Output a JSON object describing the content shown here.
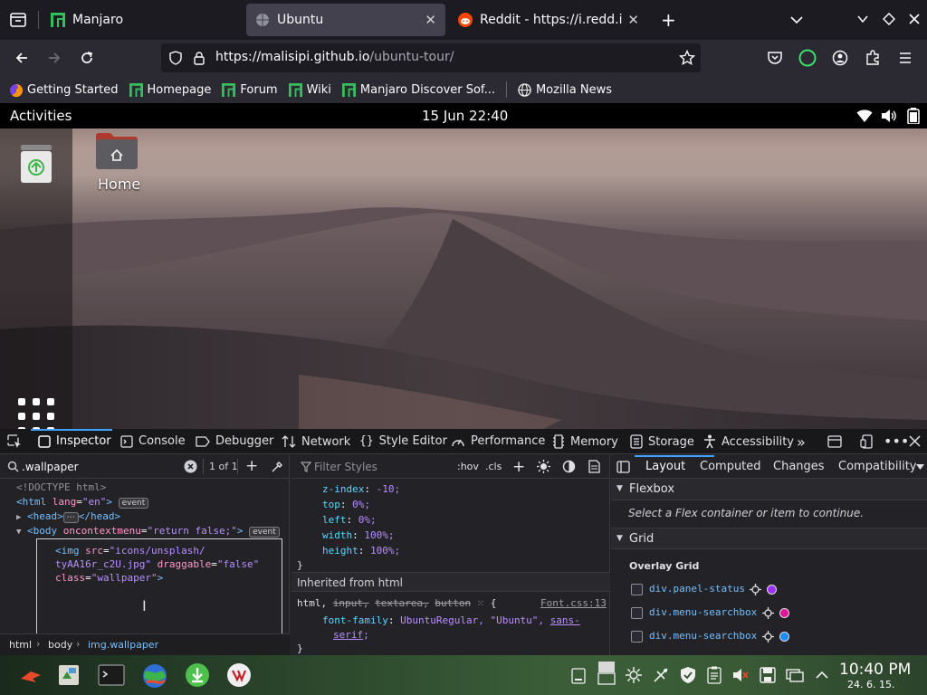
{
  "tabs": [
    {
      "title": "Manjaro",
      "icon": "manjaro-icon",
      "active": false
    },
    {
      "title": "Ubuntu",
      "icon": "ubuntu-globe-icon",
      "active": true
    },
    {
      "title": "Reddit - https://i.redd.it/xi",
      "icon": "reddit-icon",
      "active": false
    }
  ],
  "url": {
    "host": "https://malisipi.github.io",
    "path": "/ubuntu-tour/"
  },
  "bookmarks": [
    {
      "label": "Getting Started",
      "icon": "firefox-icon"
    },
    {
      "label": "Homepage",
      "icon": "manjaro-icon"
    },
    {
      "label": "Forum",
      "icon": "manjaro-icon"
    },
    {
      "label": "Wiki",
      "icon": "manjaro-icon"
    },
    {
      "label": "Manjaro Discover Sof...",
      "icon": "manjaro-icon"
    },
    {
      "label": "Mozilla News",
      "icon": "globe-icon"
    }
  ],
  "ubuntu": {
    "activities": "Activities",
    "clock": "15 Jun 22:40",
    "home_label": "Home"
  },
  "devtools": {
    "tabs": [
      "Inspector",
      "Console",
      "Debugger",
      "Network",
      "Style Editor",
      "Performance",
      "Memory",
      "Storage",
      "Accessibility"
    ],
    "search_value": ".wallpaper",
    "search_count": "1 of 1",
    "filter_placeholder": "Filter Styles",
    "hov": ":hov",
    "cls": ".cls",
    "html_lines": {
      "doctype": "<!DOCTYPE html>",
      "html_open": "<html",
      "html_attr": "lang",
      "html_val": "\"en\"",
      "event1": "event",
      "head_open": "<head>",
      "head_close": "</head>",
      "body_open": "<body",
      "body_attr": "oncontextmenu",
      "body_val": "\"return false;\"",
      "event2": "event",
      "img_l1_tag": "<img",
      "img_l1_attr": "src",
      "img_l1_val": "\"icons/unsplash/",
      "img_l2_val": "tyAA16r_c2U.jpg\"",
      "img_l2_attr": "draggable",
      "img_l2_val2": "\"false\"",
      "img_l3_attr": "class",
      "img_l3_val": "\"wallpaper\""
    },
    "breadcrumbs": [
      "html",
      "body",
      "img.wallpaper"
    ],
    "css_rules": [
      {
        "prop": "z-index",
        "value": "-10;"
      },
      {
        "prop": "top",
        "value": "0%;"
      },
      {
        "prop": "left",
        "value": "0%;"
      },
      {
        "prop": "width",
        "value": "100%;"
      },
      {
        "prop": "height",
        "value": "100%;"
      }
    ],
    "inherited_header": "Inherited from html",
    "inherited_selector_html": "html,",
    "inherited_selector_input": "input,",
    "inherited_selector_textarea": "textarea,",
    "inherited_selector_button": "button",
    "inherited_source": "Font.css:13",
    "font_prop": "font-family",
    "font_value1": "UbuntuRegular, \"Ubuntu\", ",
    "font_value2": "sans-",
    "font_value3": "serif",
    "layout_tabs": [
      "Layout",
      "Computed",
      "Changes",
      "Compatibility"
    ],
    "flexbox_header": "Flexbox",
    "flexbox_hint": "Select a Flex container or item to continue.",
    "grid_header": "Grid",
    "overlay_grid": "Overlay Grid",
    "grids": [
      {
        "label": "div.panel-status",
        "color": "#9b30ff"
      },
      {
        "label": "div.menu-searchbox",
        "color": "#e0169a"
      },
      {
        "label": "div.menu-searchbox",
        "color": "#1a8cff"
      }
    ]
  },
  "taskbar": {
    "clock_time": "10:40 PM",
    "clock_date": "24. 6. 15."
  }
}
